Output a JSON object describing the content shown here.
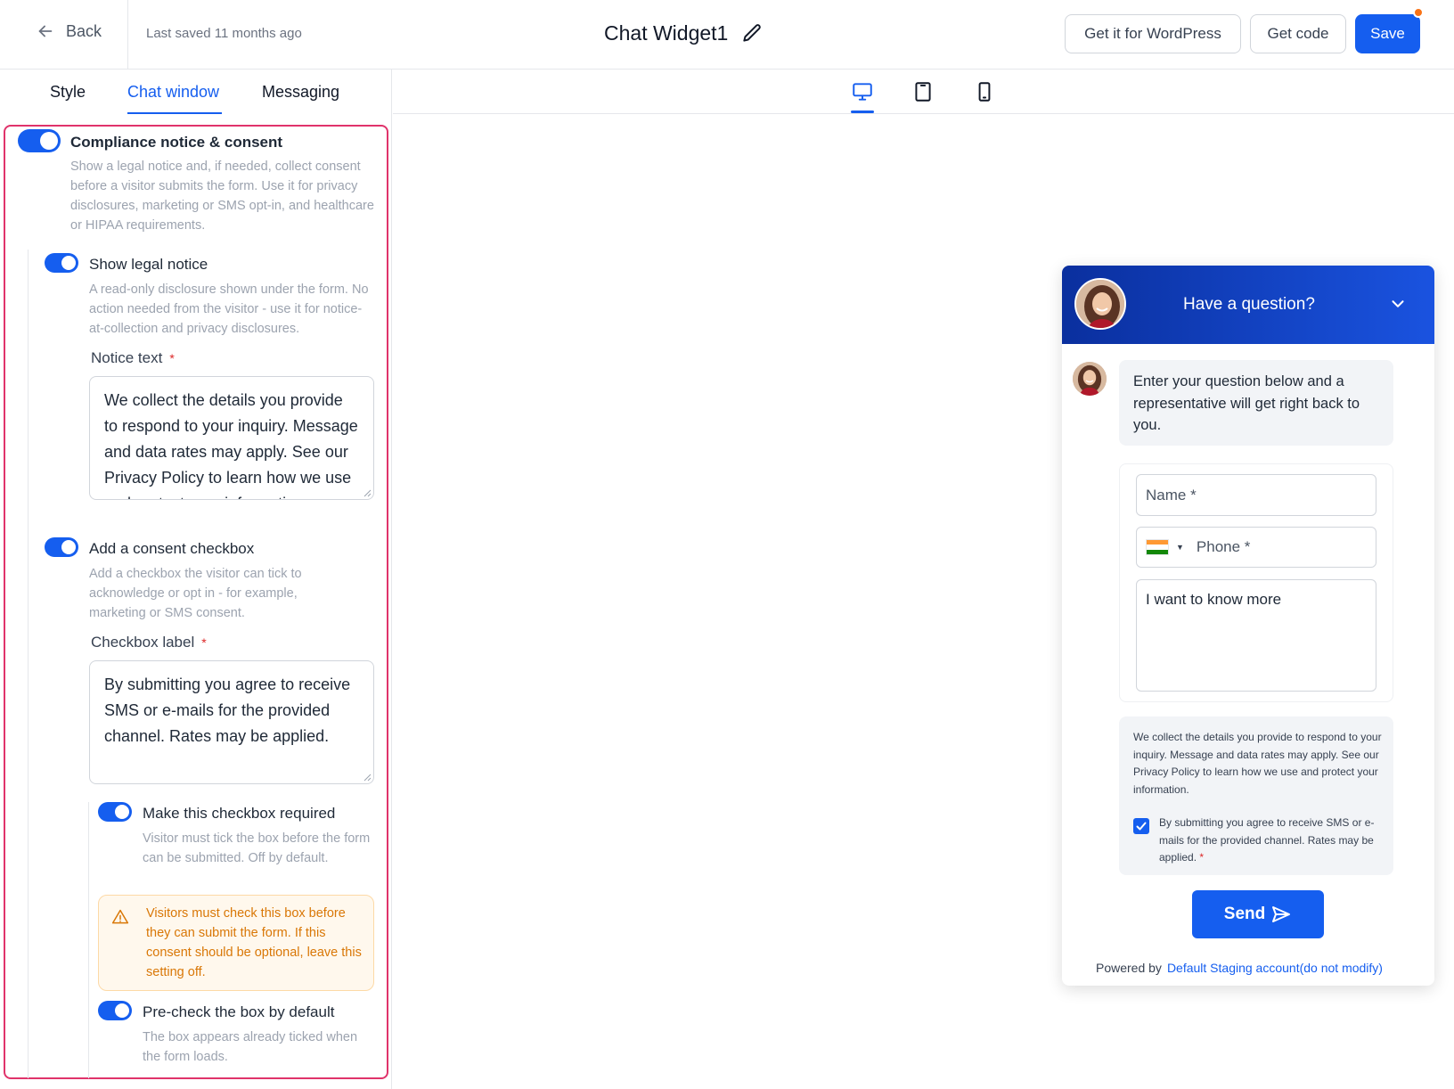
{
  "header": {
    "back_label": "Back",
    "last_saved": "Last saved 11 months ago",
    "widget_title": "Chat Widget1",
    "wordpress_button": "Get it for WordPress",
    "code_button": "Get code",
    "save_button": "Save"
  },
  "tabs": [
    {
      "label": "Style",
      "active": false
    },
    {
      "label": "Chat window",
      "active": true
    },
    {
      "label": "Messaging",
      "active": false
    }
  ],
  "compliance": {
    "title": "Compliance notice & consent",
    "enabled": true,
    "description": "Show a legal notice and, if needed, collect consent before a visitor submits the form. Use it for privacy disclosures, marketing or SMS opt-in, and healthcare or HIPAA requirements.",
    "legal_notice": {
      "title": "Show legal notice",
      "enabled": true,
      "description": "A read-only disclosure shown under the form. No action needed from the visitor - use it for notice-at-collection and privacy disclosures.",
      "field_label": "Notice text",
      "required_mark": "*",
      "value": "We collect the details you provide to respond to your inquiry. Message and data rates may apply. See our Privacy Policy to learn how we use and protect your information."
    },
    "consent_checkbox": {
      "title": "Add a consent checkbox",
      "enabled": true,
      "description": "Add a checkbox the visitor can tick to acknowledge or opt in - for example, marketing or SMS consent.",
      "field_label": "Checkbox label",
      "required_mark": "*",
      "value": "By submitting you agree to receive SMS or e-mails for the provided channel. Rates may be applied.",
      "required_option": {
        "title": "Make this checkbox required",
        "enabled": true,
        "description": "Visitor must tick the box before the form can be submitted. Off by default."
      },
      "warning": "Visitors must check this box before they can submit the form. If this consent should be optional, leave this setting off.",
      "precheck_option": {
        "title": "Pre-check the box by default",
        "enabled": true,
        "description": "The box appears already ticked when the form loads."
      }
    }
  },
  "device_icons": [
    "desktop-icon",
    "tablet-icon",
    "mobile-icon"
  ],
  "chat_widget": {
    "header_title": "Have a question?",
    "greeting": "Enter your question below and a representative will get right back to you.",
    "name_placeholder": "Name *",
    "phone_placeholder": "Phone *",
    "message_value": "I want to know more",
    "legal_text": "We collect the details you provide to respond to your inquiry. Message and data rates may apply. See our Privacy Policy to learn how we use and protect your information.",
    "consent_label": "By submitting you agree to receive SMS or e-mails for the provided channel. Rates may be applied.",
    "consent_required_mark": "*",
    "consent_checked": true,
    "send_label": "Send",
    "powered_by": "Powered by",
    "account_link": "Default Staging account(do not modify)"
  },
  "colors": {
    "accent": "#155eef",
    "highlight_border": "#e0336b",
    "warning_text": "#d97706",
    "warning_bg": "#fff8ed"
  }
}
